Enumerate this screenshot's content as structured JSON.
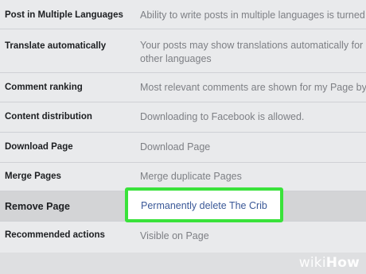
{
  "settings": {
    "rows": [
      {
        "label": "Post in Multiple Languages",
        "value_lines": [
          "Ability to write posts in multiple languages is turned o"
        ]
      },
      {
        "label": "Translate automatically",
        "value_lines": [
          "Your posts may show translations automatically for pe",
          "other languages"
        ]
      },
      {
        "label": "Comment ranking",
        "value_lines": [
          "Most relevant comments are shown for my Page by d"
        ]
      },
      {
        "label": "Content distribution",
        "value_lines": [
          "Downloading to Facebook is allowed."
        ]
      },
      {
        "label": "Download Page",
        "value_lines": [
          "Download Page"
        ]
      },
      {
        "label": "Merge Pages",
        "value_lines": [
          "Merge duplicate Pages"
        ]
      },
      {
        "label": "Remove Page",
        "value_link": "Permanently delete The Crib"
      },
      {
        "label": "Recommended actions",
        "value_lines": [
          "Visible on Page"
        ]
      }
    ]
  },
  "highlight_color": "#39e23a",
  "link_color": "#3b5998",
  "watermark": {
    "wiki": "wiki",
    "how": "How"
  }
}
